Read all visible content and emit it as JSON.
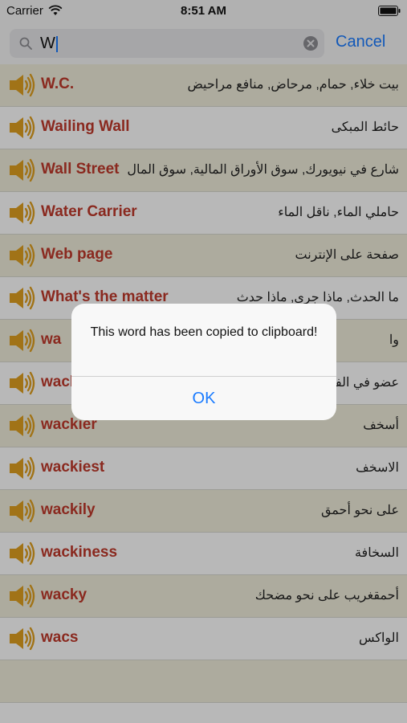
{
  "status_bar": {
    "carrier": "Carrier",
    "time": "8:51 AM"
  },
  "search": {
    "query": "W",
    "cancel_label": "Cancel"
  },
  "list": [
    {
      "word": "W.C.",
      "meaning": "بيت خلاء, حمام, مرحاض, منافع مراحيض"
    },
    {
      "word": "Wailing Wall",
      "meaning": "حائط المبكى"
    },
    {
      "word": "Wall Street",
      "meaning": "شارع في نيويورك, سوق الأوراق المالية, سوق المال"
    },
    {
      "word": "Water Carrier",
      "meaning": "حاملي الماء, ناقل الماء"
    },
    {
      "word": "Web page",
      "meaning": "صفحة على الإنترنت"
    },
    {
      "word": "What's the matter",
      "meaning": "ما الحدث, ماذا جرى, ماذا حدث"
    },
    {
      "word": "wa",
      "meaning": "وا"
    },
    {
      "word": "wacko",
      "meaning": "عضو في الفرقة"
    },
    {
      "word": "wackier",
      "meaning": "أسخف"
    },
    {
      "word": "wackiest",
      "meaning": "الاسخف"
    },
    {
      "word": "wackily",
      "meaning": "على نحو أحمق"
    },
    {
      "word": "wackiness",
      "meaning": "السخافة"
    },
    {
      "word": "wacky",
      "meaning": "أحمقغريب على نحو مضحك"
    },
    {
      "word": "wacs",
      "meaning": "الواكس"
    },
    {
      "word": "",
      "meaning": ""
    }
  ],
  "alert": {
    "message": "This word has been copied to clipboard!",
    "ok_label": "OK"
  },
  "colors": {
    "accent": "#1a7bff",
    "word": "#c0392b",
    "row_tan": "#f0eedc",
    "speaker": "#e0a020"
  }
}
